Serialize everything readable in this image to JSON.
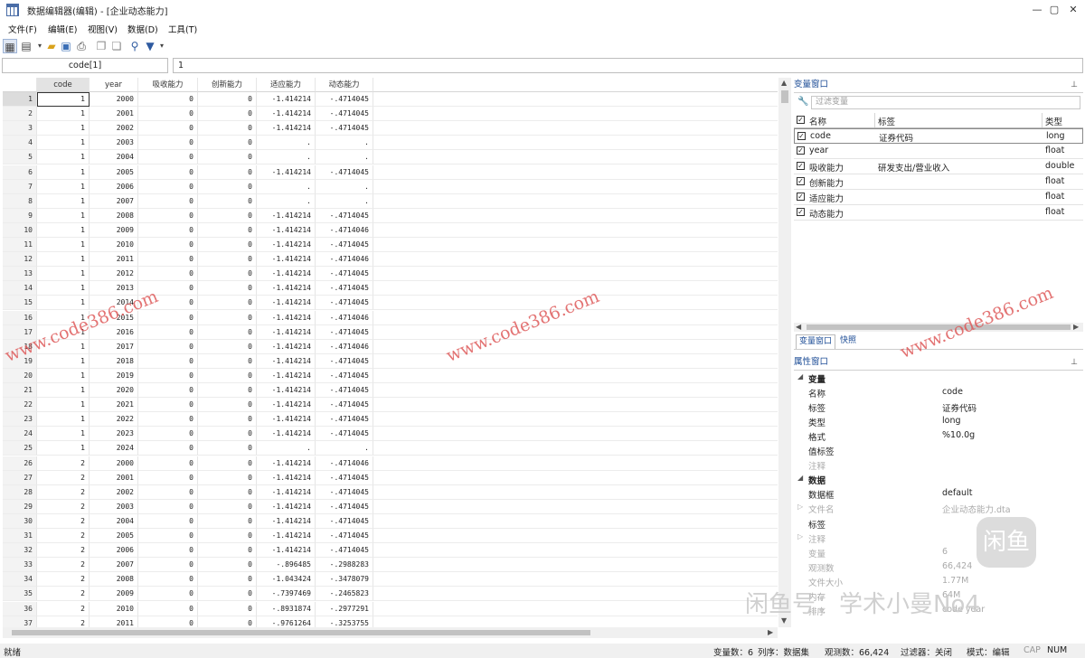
{
  "window": {
    "title": "数据编辑器(编辑) - [企业动态能力]",
    "minimize": "—",
    "restore": "▢",
    "close": "✕"
  },
  "menu": [
    "文件(F)",
    "编辑(E)",
    "视图(V)",
    "数据(D)",
    "工具(T)"
  ],
  "toolbar_icons": [
    "data-editor-icon",
    "view-dropdown-icon",
    "open-folder-icon",
    "save-icon",
    "print-icon",
    "copy-icon",
    "paste-icon",
    "search-icon",
    "filter-icon"
  ],
  "cellbar": {
    "name": "code[1]",
    "value": "1"
  },
  "grid": {
    "columns": [
      "code",
      "year",
      "吸收能力",
      "创新能力",
      "适应能力",
      "动态能力"
    ],
    "rows": [
      [
        "1",
        "1",
        "2000",
        "0",
        "0",
        "-1.414214",
        "-.4714045"
      ],
      [
        "2",
        "1",
        "2001",
        "0",
        "0",
        "-1.414214",
        "-.4714045"
      ],
      [
        "3",
        "1",
        "2002",
        "0",
        "0",
        "-1.414214",
        "-.4714045"
      ],
      [
        "4",
        "1",
        "2003",
        "0",
        "0",
        ".",
        "."
      ],
      [
        "5",
        "1",
        "2004",
        "0",
        "0",
        ".",
        "."
      ],
      [
        "6",
        "1",
        "2005",
        "0",
        "0",
        "-1.414214",
        "-.4714045"
      ],
      [
        "7",
        "1",
        "2006",
        "0",
        "0",
        ".",
        "."
      ],
      [
        "8",
        "1",
        "2007",
        "0",
        "0",
        ".",
        "."
      ],
      [
        "9",
        "1",
        "2008",
        "0",
        "0",
        "-1.414214",
        "-.4714045"
      ],
      [
        "10",
        "1",
        "2009",
        "0",
        "0",
        "-1.414214",
        "-.4714046"
      ],
      [
        "11",
        "1",
        "2010",
        "0",
        "0",
        "-1.414214",
        "-.4714045"
      ],
      [
        "12",
        "1",
        "2011",
        "0",
        "0",
        "-1.414214",
        "-.4714046"
      ],
      [
        "13",
        "1",
        "2012",
        "0",
        "0",
        "-1.414214",
        "-.4714045"
      ],
      [
        "14",
        "1",
        "2013",
        "0",
        "0",
        "-1.414214",
        "-.4714045"
      ],
      [
        "15",
        "1",
        "2014",
        "0",
        "0",
        "-1.414214",
        "-.4714045"
      ],
      [
        "16",
        "1",
        "2015",
        "0",
        "0",
        "-1.414214",
        "-.4714046"
      ],
      [
        "17",
        "1",
        "2016",
        "0",
        "0",
        "-1.414214",
        "-.4714045"
      ],
      [
        "18",
        "1",
        "2017",
        "0",
        "0",
        "-1.414214",
        "-.4714046"
      ],
      [
        "19",
        "1",
        "2018",
        "0",
        "0",
        "-1.414214",
        "-.4714045"
      ],
      [
        "20",
        "1",
        "2019",
        "0",
        "0",
        "-1.414214",
        "-.4714045"
      ],
      [
        "21",
        "1",
        "2020",
        "0",
        "0",
        "-1.414214",
        "-.4714045"
      ],
      [
        "22",
        "1",
        "2021",
        "0",
        "0",
        "-1.414214",
        "-.4714045"
      ],
      [
        "23",
        "1",
        "2022",
        "0",
        "0",
        "-1.414214",
        "-.4714045"
      ],
      [
        "24",
        "1",
        "2023",
        "0",
        "0",
        "-1.414214",
        "-.4714045"
      ],
      [
        "25",
        "1",
        "2024",
        "0",
        "0",
        ".",
        "."
      ],
      [
        "26",
        "2",
        "2000",
        "0",
        "0",
        "-1.414214",
        "-.4714046"
      ],
      [
        "27",
        "2",
        "2001",
        "0",
        "0",
        "-1.414214",
        "-.4714045"
      ],
      [
        "28",
        "2",
        "2002",
        "0",
        "0",
        "-1.414214",
        "-.4714045"
      ],
      [
        "29",
        "2",
        "2003",
        "0",
        "0",
        "-1.414214",
        "-.4714045"
      ],
      [
        "30",
        "2",
        "2004",
        "0",
        "0",
        "-1.414214",
        "-.4714045"
      ],
      [
        "31",
        "2",
        "2005",
        "0",
        "0",
        "-1.414214",
        "-.4714045"
      ],
      [
        "32",
        "2",
        "2006",
        "0",
        "0",
        "-1.414214",
        "-.4714045"
      ],
      [
        "33",
        "2",
        "2007",
        "0",
        "0",
        "-.896485",
        "-.2988283"
      ],
      [
        "34",
        "2",
        "2008",
        "0",
        "0",
        "-1.043424",
        "-.3478079"
      ],
      [
        "35",
        "2",
        "2009",
        "0",
        "0",
        "-.7397469",
        "-.2465823"
      ],
      [
        "36",
        "2",
        "2010",
        "0",
        "0",
        "-.8931874",
        "-.2977291"
      ],
      [
        "37",
        "2",
        "2011",
        "0",
        "0",
        "-.9761264",
        "-.3253755"
      ]
    ]
  },
  "variables_window": {
    "title": "变量窗口",
    "filter_placeholder": "过滤变量",
    "headers": [
      "名称",
      "标签",
      "类型"
    ],
    "items": [
      {
        "name": "code",
        "label": "证券代码",
        "type": "long"
      },
      {
        "name": "year",
        "label": "",
        "type": "float"
      },
      {
        "name": "吸收能力",
        "label": "研发支出/营业收入",
        "type": "double"
      },
      {
        "name": "创新能力",
        "label": "",
        "type": "float"
      },
      {
        "name": "适应能力",
        "label": "",
        "type": "float"
      },
      {
        "name": "动态能力",
        "label": "",
        "type": "float"
      }
    ]
  },
  "tabs": [
    "变量窗口",
    "快照"
  ],
  "properties_window": {
    "title": "属性窗口",
    "var_group": "变量",
    "var_props": [
      {
        "k": "名称",
        "v": "code"
      },
      {
        "k": "标签",
        "v": "证券代码"
      },
      {
        "k": "类型",
        "v": "long"
      },
      {
        "k": "格式",
        "v": "%10.0g"
      },
      {
        "k": "值标签",
        "v": ""
      },
      {
        "k": "注释",
        "v": ""
      }
    ],
    "data_group": "数据",
    "data_props": [
      {
        "k": "数据框",
        "v": "default"
      },
      {
        "k": "文件名",
        "v": "企业动态能力.dta"
      },
      {
        "k": "标签",
        "v": ""
      },
      {
        "k": "注释",
        "v": ""
      },
      {
        "k": "变量",
        "v": "6"
      },
      {
        "k": "观测数",
        "v": "66,424"
      },
      {
        "k": "文件大小",
        "v": "1.77M"
      },
      {
        "k": "内存",
        "v": "64M"
      },
      {
        "k": "排序",
        "v": "code year"
      }
    ]
  },
  "status": {
    "ready": "就绪",
    "vars": "变量数：6",
    "order": "列序：数据集",
    "obs": "观测数：66,424",
    "filter": "过滤器：关闭",
    "mode": "模式：编辑",
    "cap": "CAP",
    "num": "NUM"
  },
  "watermarks": [
    "www.code386.com",
    "闲鱼号：学术小曼No4"
  ],
  "logo_text": "闲鱼"
}
